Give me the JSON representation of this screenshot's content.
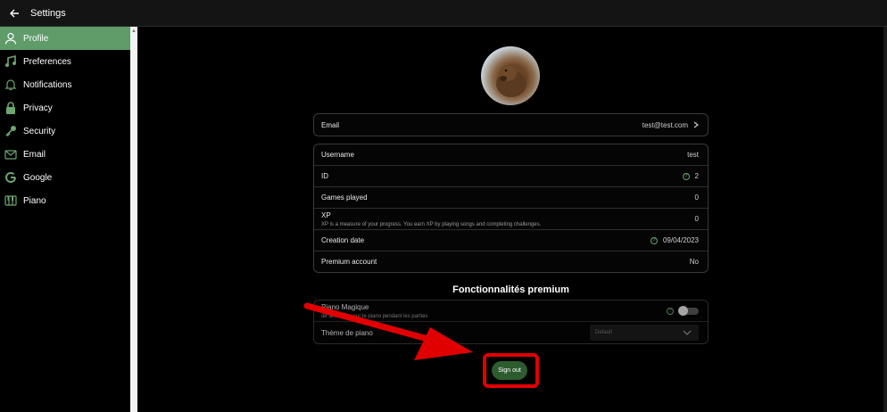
{
  "header": {
    "title": "Settings"
  },
  "sidebar": {
    "items": [
      {
        "label": "Profile",
        "icon": "person-icon",
        "active": true
      },
      {
        "label": "Preferences",
        "icon": "music-note-icon"
      },
      {
        "label": "Notifications",
        "icon": "bell-icon"
      },
      {
        "label": "Privacy",
        "icon": "lock-icon"
      },
      {
        "label": "Security",
        "icon": "key-icon"
      },
      {
        "label": "Email",
        "icon": "envelope-icon"
      },
      {
        "label": "Google",
        "icon": "google-icon"
      },
      {
        "label": "Piano",
        "icon": "piano-icon"
      }
    ]
  },
  "profile": {
    "email": {
      "label": "Email",
      "value": "test@test.com"
    },
    "rows": {
      "username": {
        "label": "Username",
        "value": "test"
      },
      "id": {
        "label": "ID",
        "value": "2"
      },
      "games_played": {
        "label": "Games played",
        "value": "0"
      },
      "xp": {
        "label": "XP",
        "description": "XP is a measure of your progress. You earn XP by playing songs and completing challenges.",
        "value": "0"
      },
      "creation_date": {
        "label": "Creation date",
        "value": "09/04/2023"
      },
      "premium_account": {
        "label": "Premium account",
        "value": "No"
      }
    }
  },
  "premium": {
    "title": "Fonctionnalités premium",
    "piano_magique": {
      "label": "Piano Magique",
      "description": "de la lumière sur le piano pendant les parties"
    },
    "theme": {
      "label": "Thème de piano",
      "selected": "Default"
    }
  },
  "signout_label": "Sign out",
  "colors": {
    "accent": "#5f9c6a",
    "signout_bg": "#2d5c2f",
    "annotation_red": "#e10000"
  }
}
